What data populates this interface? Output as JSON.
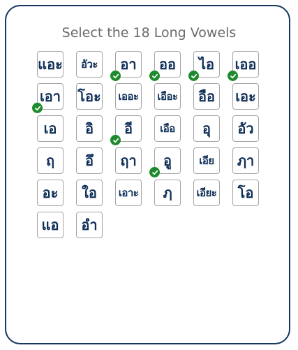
{
  "title": "Select the 18 Long Vowels",
  "tiles": [
    {
      "text": "แอะ",
      "selected": false
    },
    {
      "text": "อัวะ",
      "selected": false
    },
    {
      "text": "อา",
      "selected": true
    },
    {
      "text": "ออ",
      "selected": true
    },
    {
      "text": "ไอ",
      "selected": true
    },
    {
      "text": "เออ",
      "selected": true
    },
    {
      "text": "เอา",
      "selected": true
    },
    {
      "text": "โอะ",
      "selected": false
    },
    {
      "text": "เออะ",
      "selected": false
    },
    {
      "text": "เอือะ",
      "selected": false
    },
    {
      "text": "อือ",
      "selected": false
    },
    {
      "text": "เอะ",
      "selected": false
    },
    {
      "text": "เอ",
      "selected": false
    },
    {
      "text": "อิ",
      "selected": false
    },
    {
      "text": "อี",
      "selected": true
    },
    {
      "text": "เอือ",
      "selected": false
    },
    {
      "text": "อุ",
      "selected": false
    },
    {
      "text": "อัว",
      "selected": false
    },
    {
      "text": "ฤ",
      "selected": false
    },
    {
      "text": "อึ",
      "selected": false
    },
    {
      "text": "ฤา",
      "selected": false
    },
    {
      "text": "อู",
      "selected": true
    },
    {
      "text": "เอีย",
      "selected": false
    },
    {
      "text": "ฦา",
      "selected": false
    },
    {
      "text": "อะ",
      "selected": false
    },
    {
      "text": "ใอ",
      "selected": false
    },
    {
      "text": "เอาะ",
      "selected": false
    },
    {
      "text": "ฦ",
      "selected": false
    },
    {
      "text": "เอียะ",
      "selected": false
    },
    {
      "text": "โอ",
      "selected": false
    },
    {
      "text": "แอ",
      "selected": false
    },
    {
      "text": "อำ",
      "selected": false
    }
  ],
  "colors": {
    "border": "#16375f",
    "glyph": "#0f2f57",
    "check": "#1e8a2d"
  },
  "icons": {
    "selected": "checkmark-icon"
  }
}
